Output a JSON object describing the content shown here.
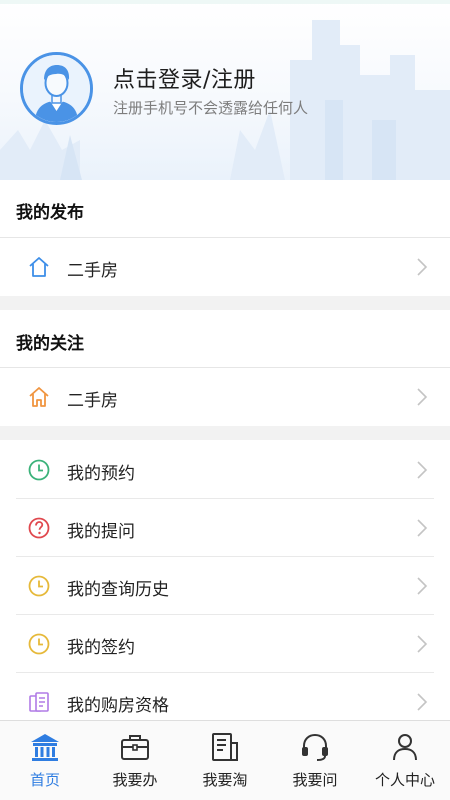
{
  "header": {
    "title": "点击登录/注册",
    "subtitle": "注册手机号不会透露给任何人"
  },
  "sections": {
    "published": {
      "title": "我的发布",
      "items": [
        {
          "label": "二手房",
          "icon": "house-outline-icon"
        }
      ]
    },
    "following": {
      "title": "我的关注",
      "items": [
        {
          "label": "二手房",
          "icon": "house-outline-icon"
        }
      ]
    },
    "personal": {
      "items": [
        {
          "label": "我的预约",
          "icon": "clock-icon",
          "color": "#3bb27a"
        },
        {
          "label": "我的提问",
          "icon": "question-icon",
          "color": "#e0484e"
        },
        {
          "label": "我的查询历史",
          "icon": "clock-icon",
          "color": "#e6b93a"
        },
        {
          "label": "我的签约",
          "icon": "clock-icon",
          "color": "#e6b93a"
        },
        {
          "label": "我的购房资格",
          "icon": "document-icon",
          "color": "#b07be6"
        }
      ]
    }
  },
  "tabbar": {
    "tabs": [
      {
        "label": "首页",
        "icon": "bank-icon",
        "active": true
      },
      {
        "label": "我要办",
        "icon": "briefcase-icon",
        "active": false
      },
      {
        "label": "我要淘",
        "icon": "document-list-icon",
        "active": false
      },
      {
        "label": "我要问",
        "icon": "headset-icon",
        "active": false
      },
      {
        "label": "个人中心",
        "icon": "user-icon",
        "active": false
      }
    ]
  },
  "colors": {
    "accent": "#2f7de1",
    "avatar_ring": "#4a93e6",
    "house_publish": "#3d8ee8",
    "house_follow": "#f09540"
  }
}
